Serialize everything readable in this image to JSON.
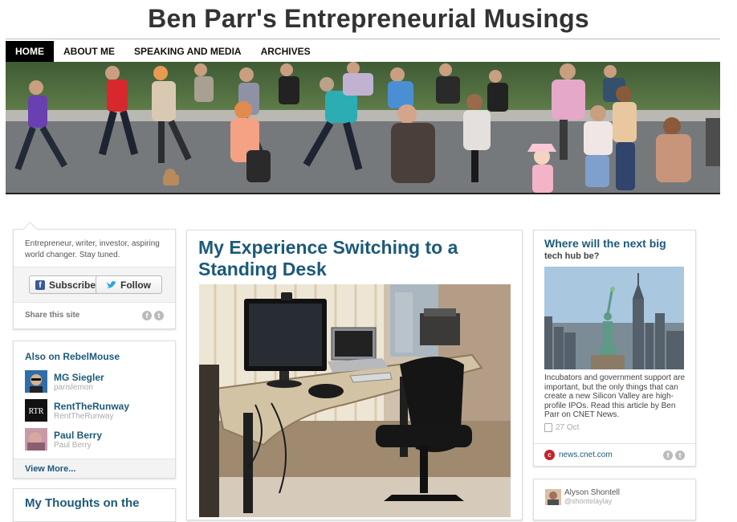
{
  "site": {
    "title": "Ben Parr's Entrepreneurial Musings"
  },
  "nav": {
    "items": [
      {
        "label": "HOME",
        "active": true
      },
      {
        "label": "ABOUT ME"
      },
      {
        "label": "SPEAKING AND MEDIA"
      },
      {
        "label": "ARCHIVES"
      }
    ]
  },
  "profile": {
    "bio": "Entrepreneur, writer, investor, aspiring world changer. Stay tuned.",
    "subscribe_label": "Subscribe",
    "follow_label": "Follow",
    "share_label": "Share this site"
  },
  "also_on": {
    "title": "Also on RebelMouse",
    "users": [
      {
        "name": "MG Siegler",
        "handle": "parislemon"
      },
      {
        "name": "RentTheRunway",
        "handle": "RentTheRunway"
      },
      {
        "name": "Paul Berry",
        "handle": "Paul Berry"
      }
    ],
    "view_more": "View More..."
  },
  "next_card": {
    "title": "My Thoughts on the"
  },
  "post": {
    "title": "My Experience Switching to a Standing Desk"
  },
  "side_story": {
    "title": "Where will the next big",
    "subtitle": "tech hub be?",
    "body": "Incubators and government support are important, but the only things that can create a new Silicon Valley are high-profile IPOs. Read this article by Ben Parr on CNET News.",
    "date": "27 Oct",
    "source": "news.cnet.com"
  },
  "shared_by": {
    "name": "Alyson Shontell",
    "handle": "@shontelaylay"
  },
  "colors": {
    "link": "#1b5a7a",
    "nav_active_bg": "#000000"
  }
}
